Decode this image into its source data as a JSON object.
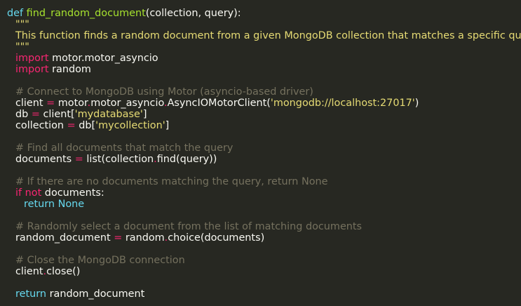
{
  "code": {
    "def_kw": "def",
    "func_name": "find_random_document",
    "func_sig": "(collection, query):",
    "doc_open": "\"\"\"",
    "doc_text": "This function finds a random document from a given MongoDB collection that matches a specific query.",
    "doc_close": "\"\"\"",
    "import_kw": "import",
    "import1": "motor.motor_asyncio",
    "import2": "random",
    "c_connect": "# Connect to MongoDB using Motor (asyncio-based driver)",
    "client_var": "client",
    "eq": "=",
    "client_mod": "motor",
    "dot": ".",
    "client_sub": "motor_asyncio",
    "client_cls": "AsyncIOMotorClient(",
    "client_url": "'mongodb://localhost:27017'",
    "close_paren": ")",
    "db_var": "db",
    "db_expr": "client[",
    "db_name": "'mydatabase'",
    "close_bracket": "]",
    "coll_var": "collection",
    "coll_expr": "db[",
    "coll_name": "'mycollection'",
    "c_find": "# Find all documents that match the query",
    "docs_var": "documents",
    "docs_expr1": "list(collection",
    "docs_expr2": "find(query))",
    "c_none": "# If there are no documents matching the query, return None",
    "if_kw": "if",
    "not_kw": "not",
    "if_rest": " documents:",
    "return_kw": "return",
    "none_kw": "None",
    "c_select": "# Randomly select a document from the list of matching documents",
    "rand_var": "random_document",
    "rand_mod": "random",
    "rand_call": "choice(documents)",
    "c_close": "# Close the MongoDB connection",
    "close_obj": "client",
    "close_call": "close()",
    "ret_value": "random_document"
  }
}
